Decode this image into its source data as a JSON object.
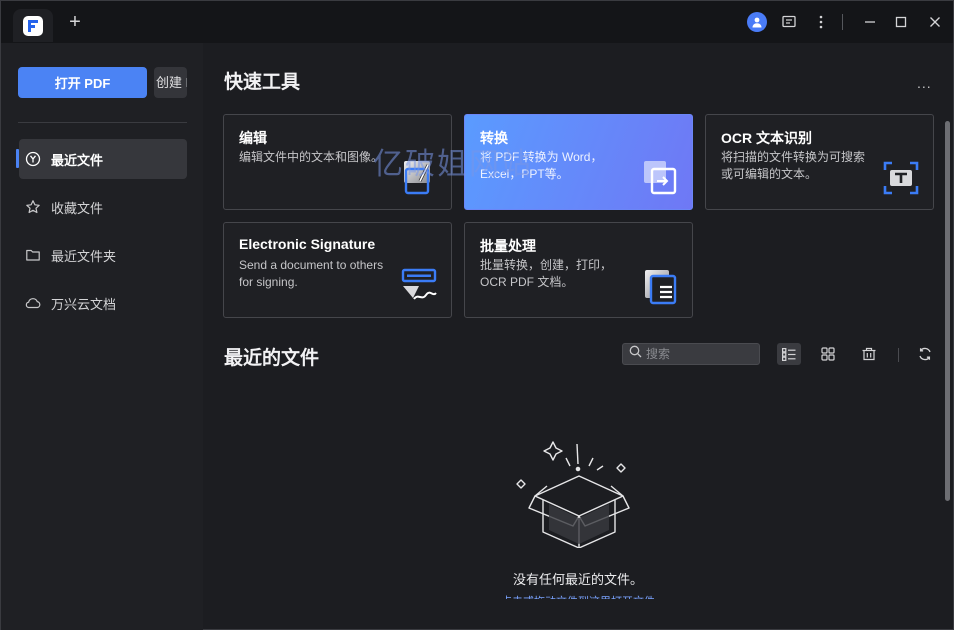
{
  "titlebar": {
    "add_tab_label": "+",
    "icons": [
      "avatar-icon",
      "feedback-icon",
      "more-vertical-icon",
      "minimize-icon",
      "maximize-icon",
      "close-icon"
    ]
  },
  "sidebar": {
    "open_pdf_label": "打开 PDF",
    "create_label": "创建 PDF",
    "items": [
      {
        "label": "最近文件",
        "icon": "recent-icon",
        "active": true
      },
      {
        "label": "收藏文件",
        "icon": "star-icon",
        "active": false
      },
      {
        "label": "最近文件夹",
        "icon": "folder-icon",
        "active": false
      },
      {
        "label": "万兴云文档",
        "icon": "cloud-icon",
        "active": false
      }
    ]
  },
  "quick_tools": {
    "title": "快速工具",
    "more_label": "...",
    "cards": [
      {
        "title": "编辑",
        "desc": "编辑文件中的文本和图像。",
        "icon": "edit-doc-icon"
      },
      {
        "title": "转换",
        "desc": "将 PDF 转换为 Word，Excel，PPT等。",
        "icon": "convert-icon"
      },
      {
        "title": "OCR 文本识别",
        "desc": "将扫描的文件转换为可搜索或可编辑的文本。",
        "icon": "ocr-icon"
      },
      {
        "title": "Electronic Signature",
        "desc": "Send a document to others for signing.",
        "icon": "signature-icon"
      },
      {
        "title": "批量处理",
        "desc": "批量转换，创建，打印，OCR PDF 文档。",
        "icon": "batch-icon"
      }
    ]
  },
  "recent": {
    "title": "最近的文件",
    "search_placeholder": "搜索",
    "empty_text": "没有任何最近的文件。",
    "empty_sub": "点击或拖动文件到这里打开文件"
  },
  "watermark": "亿破姐网站",
  "colors": {
    "accent": "#4b83f4",
    "bg": "#1c1d21",
    "sidebar": "#1f2024",
    "card_border": "#45464b"
  }
}
